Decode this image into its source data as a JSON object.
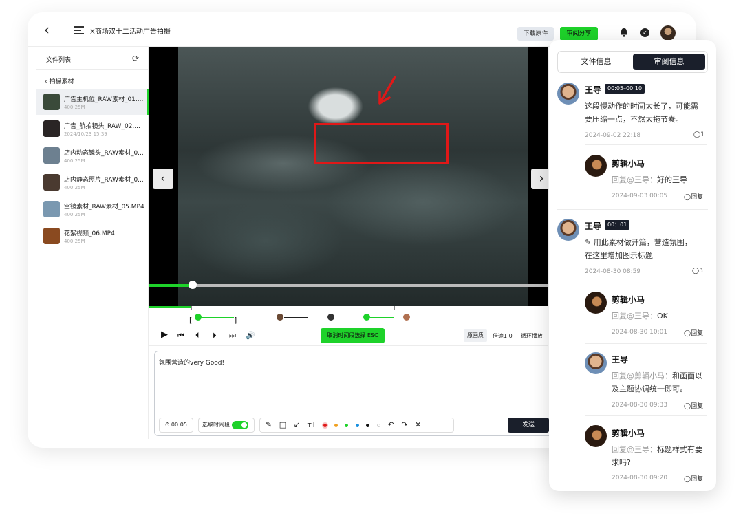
{
  "window": {
    "title": "X商场双十二活动广告拍摄",
    "download_label": "下载原件",
    "share_label": "审阅分享"
  },
  "sidebar": {
    "title": "文件列表",
    "crumb": "拍摄素材",
    "files": [
      {
        "name": "广告主机位_RAW素材_01....",
        "meta": "400.25M",
        "thumb": "#3a4a3a"
      },
      {
        "name": "广告_航拍镜头_RAW_02....",
        "meta": "2024/10/23 15:39",
        "thumb": "#2a2525"
      },
      {
        "name": "店内动态镜头_RAW素材_0...",
        "meta": "400.25M",
        "thumb": "#6d8090"
      },
      {
        "name": "店内静态照片_RAW素材_0...",
        "meta": "400.25M",
        "thumb": "#4a3a30"
      },
      {
        "name": "空镜素材_RAW素材_05.MP4",
        "meta": "400.25M",
        "thumb": "#7a98b0"
      },
      {
        "name": "花絮视频_06.MP4",
        "meta": "400.25M",
        "thumb": "#8a4a20"
      }
    ]
  },
  "player": {
    "progress": 0.11,
    "cancel_range_label": "取消时间段选择 ESC",
    "quality_label": "原画质",
    "speed_label": "倍速1.0",
    "loop_label": "循环播放"
  },
  "composer": {
    "text": "氛围营造的very Good!",
    "timestamp": "00:05",
    "range_label": "选取时间段",
    "send_label": "发送",
    "colors": [
      "#e01818",
      "#f0a020",
      "#1ed22a",
      "#1a90e0",
      "#111111",
      "#dddddd"
    ]
  },
  "panel": {
    "tab_file": "文件信息",
    "tab_review": "审阅信息",
    "comments": [
      {
        "name": "王导",
        "badge": "00:05–00:10",
        "body1": "这段慢动作的时间太长了，可能需",
        "body2": "要压缩一点，不然太拖节奏。",
        "time": "2024-09-02 22:18",
        "count": "1"
      },
      {
        "name": "剪辑小马",
        "reply_at": "回复@王导：",
        "reply": "好的王导",
        "time": "2024-09-03 00:05",
        "action": "回复"
      },
      {
        "name": "王导",
        "badge": "00：01",
        "body1": "用此素材做开篇，营造氛围，",
        "body2": "在这里增加图示标题",
        "time": "2024-08-30 08:59",
        "count": "3"
      },
      {
        "name": "剪辑小马",
        "reply_at": "回复@王导：",
        "reply": "OK",
        "time": "2024-08-30 10:01",
        "action": "回复"
      },
      {
        "name": "王导",
        "reply_at": "回复@剪辑小马：",
        "reply": "和画面以",
        "reply2": "及主题协调统一即可。",
        "time": "2024-08-30 09:33",
        "action": "回复"
      },
      {
        "name": "剪辑小马",
        "reply_at": "回复@王导：",
        "reply": "标题样式有要",
        "reply2": "求吗?",
        "time": "2024-08-30 09:20",
        "action": "回复"
      }
    ]
  }
}
